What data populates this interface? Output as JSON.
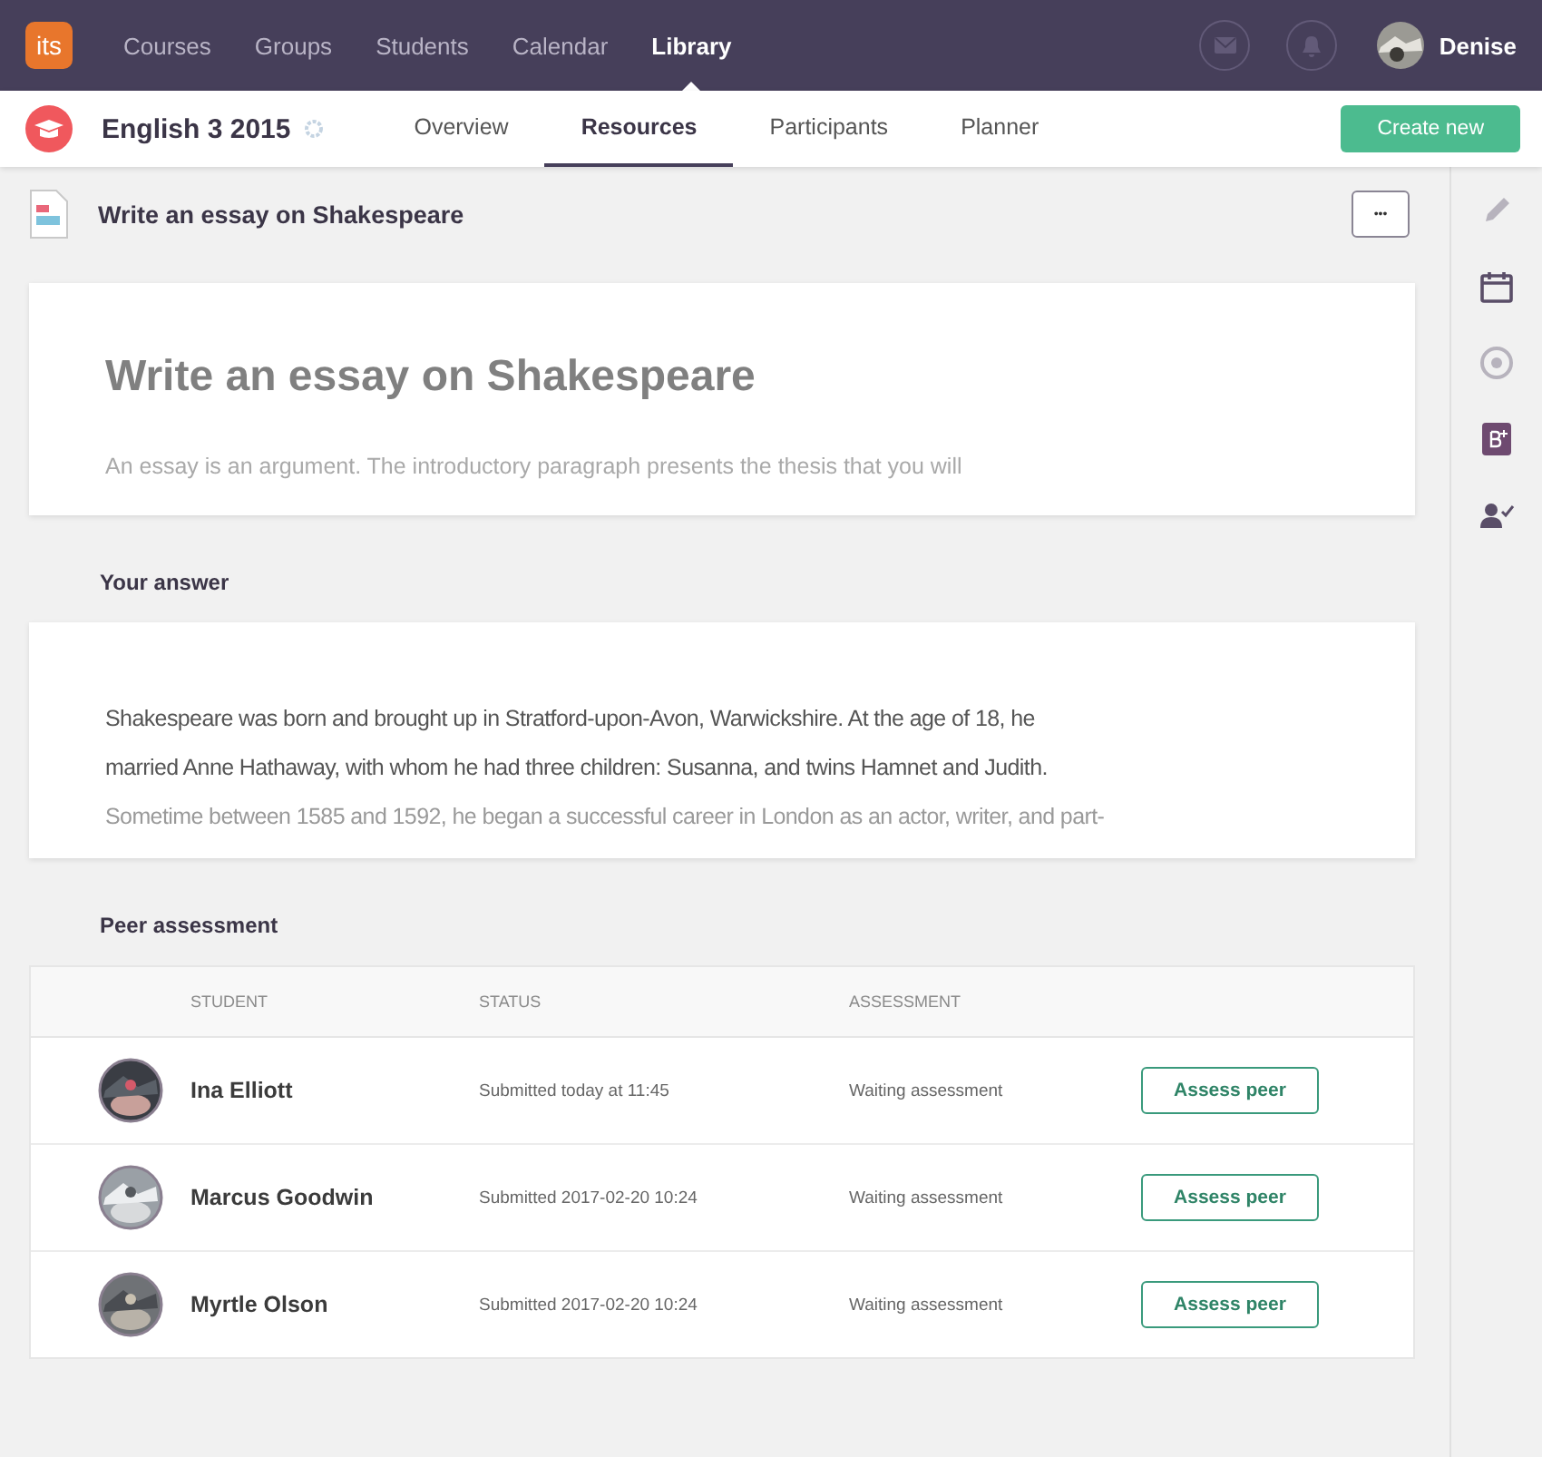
{
  "topnav": {
    "logo": "its",
    "items": [
      {
        "label": "Courses",
        "selected": false
      },
      {
        "label": "Groups",
        "selected": false
      },
      {
        "label": "Students",
        "selected": false
      },
      {
        "label": "Calendar",
        "selected": false
      },
      {
        "label": "Library",
        "selected": true
      }
    ],
    "user": "Denise"
  },
  "subnav": {
    "course": "English 3 2015",
    "tabs": [
      {
        "label": "Overview",
        "selected": false
      },
      {
        "label": "Resources",
        "selected": true
      },
      {
        "label": "Participants",
        "selected": false
      },
      {
        "label": "Planner",
        "selected": false
      }
    ],
    "action": "Create new"
  },
  "page": {
    "title": "Write an essay on Shakespeare",
    "more": "•••"
  },
  "assignment": {
    "heading": "Write an essay on Shakespeare",
    "intro": "An essay is an argument. The introductory paragraph presents the thesis that you will"
  },
  "answer": {
    "label": "Your answer",
    "lines": [
      "Shakespeare was born and brought up in Stratford-upon-Avon, Warwickshire. At the age of 18, he",
      "married Anne Hathaway, with whom he had three children: Susanna, and twins Hamnet and Judith.",
      "Sometime between 1585 and 1592, he began a successful career in London as an actor, writer, and part-"
    ]
  },
  "peer_assessment": {
    "label": "Peer assessment",
    "columns": [
      "STUDENT",
      "STATUS",
      "ASSESSMENT"
    ],
    "rows": [
      {
        "student": "Ina Elliott",
        "status": "Submitted today at 11:45",
        "assessment": "Waiting assessment",
        "action": "Assess peer"
      },
      {
        "student": "Marcus Goodwin",
        "status": "Submitted 2017-02-20 10:24",
        "assessment": "Waiting assessment",
        "action": "Assess peer"
      },
      {
        "student": "Myrtle Olson",
        "status": "Submitted 2017-02-20 10:24",
        "assessment": "Waiting assessment",
        "action": "Assess peer"
      }
    ]
  }
}
